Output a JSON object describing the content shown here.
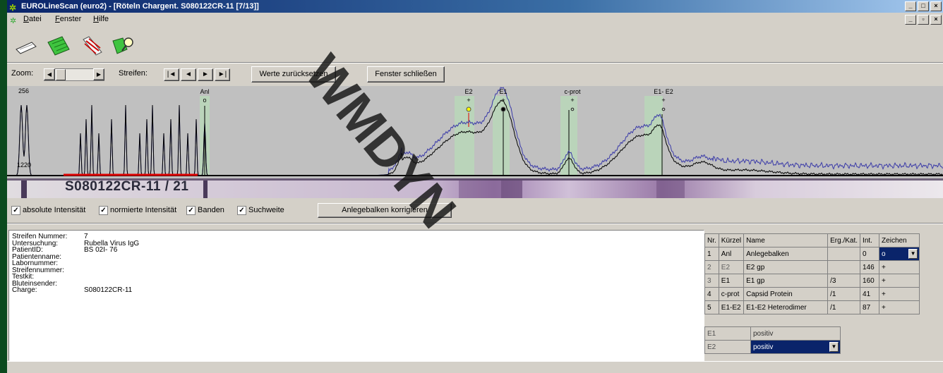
{
  "window": {
    "title": "EUROLineScan (euro2) - [Röteln Chargent. S080122CR-11 [7/13]]",
    "controls": [
      "_",
      "□",
      "×"
    ],
    "mdi_controls": [
      "_",
      "▫",
      "×"
    ]
  },
  "menu": {
    "items": [
      "Datei",
      "Fenster",
      "Hilfe"
    ]
  },
  "toolbar": {
    "tools": [
      "strip-tool-icon",
      "green-strip-icon",
      "red-lines-icon",
      "green-loupe-icon"
    ]
  },
  "controls": {
    "zoom_label": "Zoom:",
    "strips_label": "Streifen:",
    "nav": [
      "|◄",
      "◄",
      "►",
      "►|"
    ],
    "reset_values": "Werte zurücksetzen",
    "close_window": "Fenster schließen"
  },
  "graph": {
    "y_max_label": "256",
    "baseline_label": "1220",
    "band_labels": [
      {
        "name": "Anl",
        "sign": "o"
      },
      {
        "name": "E2",
        "sign": "+"
      },
      {
        "name": "E1",
        "sign": "+"
      },
      {
        "name": "c-prot",
        "sign": "+"
      },
      {
        "name": "E1- E2",
        "sign": "+"
      }
    ]
  },
  "strip": {
    "label": "S080122CR-11 / 21"
  },
  "checkboxes": [
    {
      "label": "absolute Intensität",
      "checked": true
    },
    {
      "label": "normierte Intensität",
      "checked": true
    },
    {
      "label": "Banden",
      "checked": true
    },
    {
      "label": "Suchweite",
      "checked": true
    }
  ],
  "adjust_button": "Anlegebalken korrigieren",
  "info": [
    {
      "label": "Streifen Nummer:",
      "value": "7"
    },
    {
      "label": "Untersuchung:",
      "value": "Rubella Virus IgG"
    },
    {
      "label": "PatientID:",
      "value": "BS 02I- 76"
    },
    {
      "label": "Patientenname:",
      "value": ""
    },
    {
      "label": "Labornummer:",
      "value": ""
    },
    {
      "label": "Streifennummer:",
      "value": ""
    },
    {
      "label": "Testkit:",
      "value": ""
    },
    {
      "label": "Bluteinsender:",
      "value": ""
    },
    {
      "label": "Charge:",
      "value": "S080122CR-11"
    }
  ],
  "band_table": {
    "headers": [
      "Nr.",
      "Kürzel",
      "Name",
      "Erg./Kat.",
      "Int.",
      "Zeichen"
    ],
    "rows": [
      {
        "nr": "1",
        "kurz": "Anl",
        "name": "Anlegebalken",
        "erg": "",
        "int": "0",
        "zeichen": "o"
      },
      {
        "nr": "2",
        "kurz": "E2",
        "name": "E2 gp",
        "erg": "",
        "int": "146",
        "zeichen": "+"
      },
      {
        "nr": "3",
        "kurz": "E1",
        "name": "E1 gp",
        "erg": "/3",
        "int": "160",
        "zeichen": "+"
      },
      {
        "nr": "4",
        "kurz": "c-prot",
        "name": "Capsid Protein",
        "erg": "/1",
        "int": "41",
        "zeichen": "+"
      },
      {
        "nr": "5",
        "kurz": "E1-E2",
        "name": "E1-E2 Heterodimer",
        "erg": "/1",
        "int": "87",
        "zeichen": "+"
      }
    ]
  },
  "results": [
    {
      "band": "E1",
      "value": "positiv"
    },
    {
      "band": "E2",
      "value": "positiv"
    }
  ],
  "colors": {
    "title_gradient_start": "#0a246a",
    "profile_blue": "#3a3aa8",
    "profile_black": "#000000",
    "selection": "#0a246a"
  }
}
